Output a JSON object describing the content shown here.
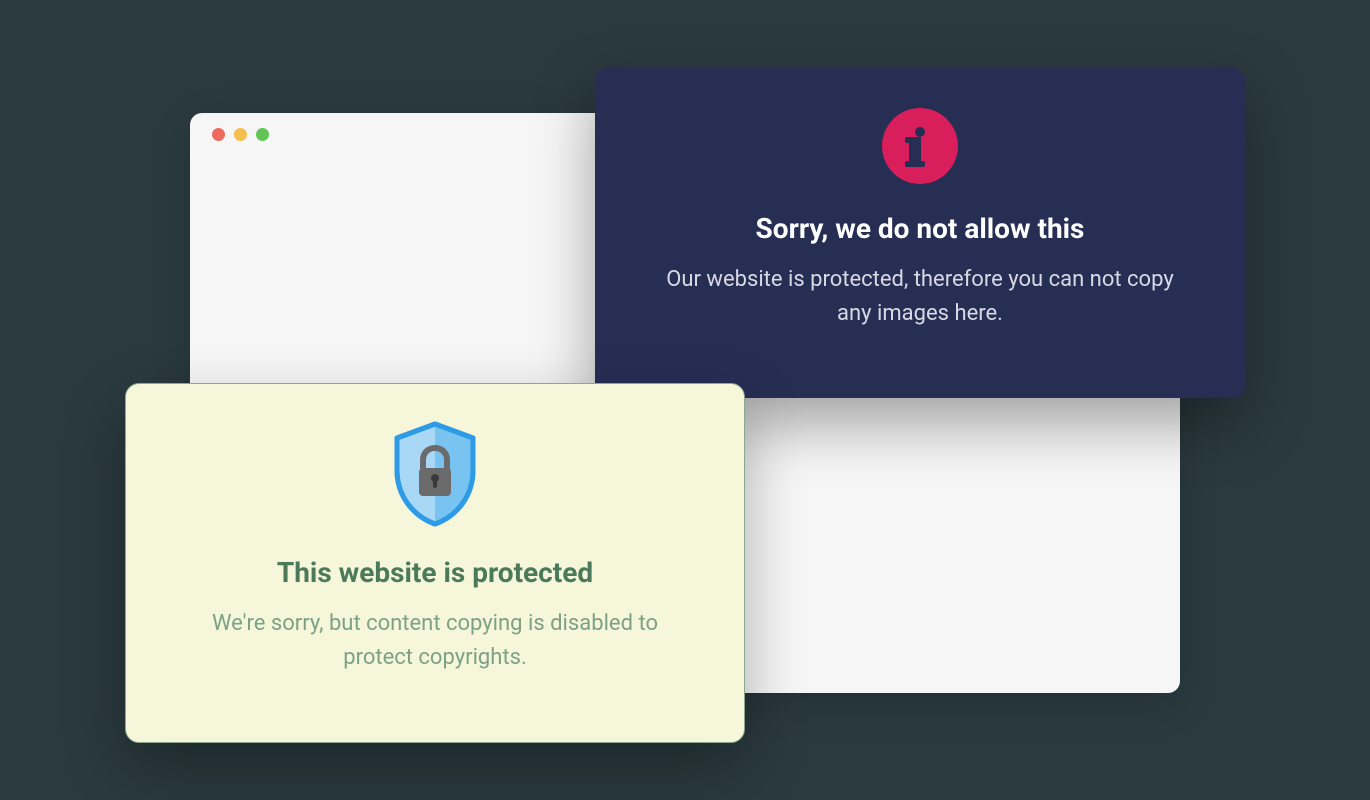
{
  "dark_card": {
    "title": "Sorry, we do not allow this",
    "message": "Our website is protected, therefore you can not copy any images here."
  },
  "light_card": {
    "title": "This website is protected",
    "message": "We're sorry, but content copying is disabled to protect copyrights."
  }
}
